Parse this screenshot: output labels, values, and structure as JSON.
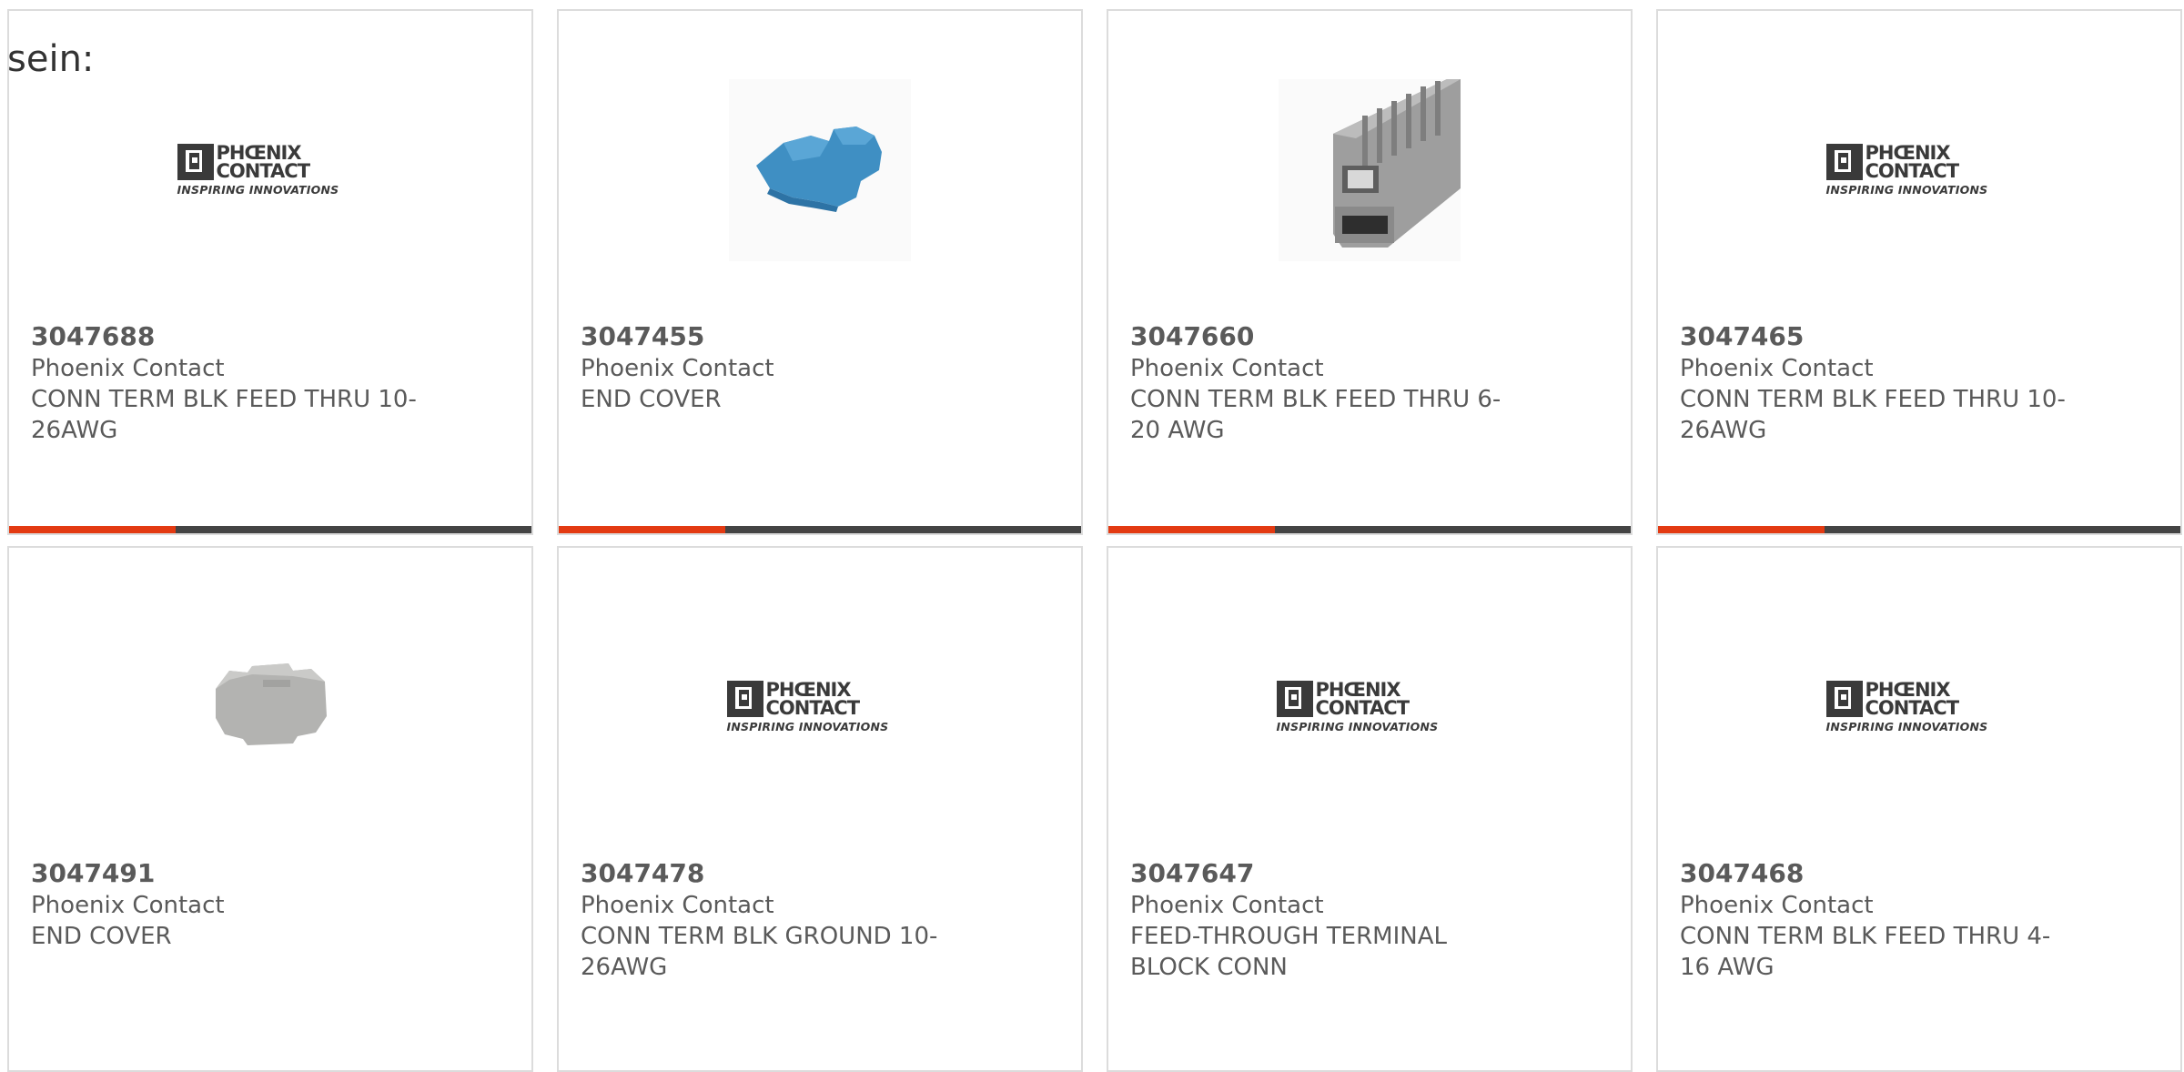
{
  "lead_text": "sein:",
  "logo": {
    "line1": "PHŒNIX",
    "line2": "CONTACT",
    "tagline": "INSPIRING INNOVATIONS"
  },
  "colors": {
    "accent": "#e33a12",
    "bar": "#444444",
    "text": "#5a5a5a",
    "border": "#dcdcdc"
  },
  "products": [
    {
      "part": "3047688",
      "manufacturer": "Phoenix Contact",
      "description": "CONN TERM BLK FEED THRU 10-26AWG",
      "image": "phoenix-contact-logo",
      "has_bar": true
    },
    {
      "part": "3047455",
      "manufacturer": "Phoenix Contact",
      "description": "END COVER",
      "image": "blue-end-cover-photo",
      "has_bar": true
    },
    {
      "part": "3047660",
      "manufacturer": "Phoenix Contact",
      "description": "CONN TERM BLK FEED THRU 6-20 AWG",
      "image": "grey-terminal-block-photo",
      "has_bar": true
    },
    {
      "part": "3047465",
      "manufacturer": "Phoenix Contact",
      "description": "CONN TERM BLK FEED THRU 10-26AWG",
      "image": "phoenix-contact-logo",
      "has_bar": true
    },
    {
      "part": "3047491",
      "manufacturer": "Phoenix Contact",
      "description": "END COVER",
      "image": "grey-end-cover-photo",
      "has_bar": false
    },
    {
      "part": "3047478",
      "manufacturer": "Phoenix Contact",
      "description": "CONN TERM BLK GROUND 10-26AWG",
      "image": "phoenix-contact-logo",
      "has_bar": false
    },
    {
      "part": "3047647",
      "manufacturer": "Phoenix Contact",
      "description": "FEED-THROUGH TERMINAL BLOCK CONN",
      "image": "phoenix-contact-logo",
      "has_bar": false
    },
    {
      "part": "3047468",
      "manufacturer": "Phoenix Contact",
      "description": "CONN TERM BLK FEED THRU 4-16 AWG",
      "image": "phoenix-contact-logo",
      "has_bar": false
    }
  ]
}
